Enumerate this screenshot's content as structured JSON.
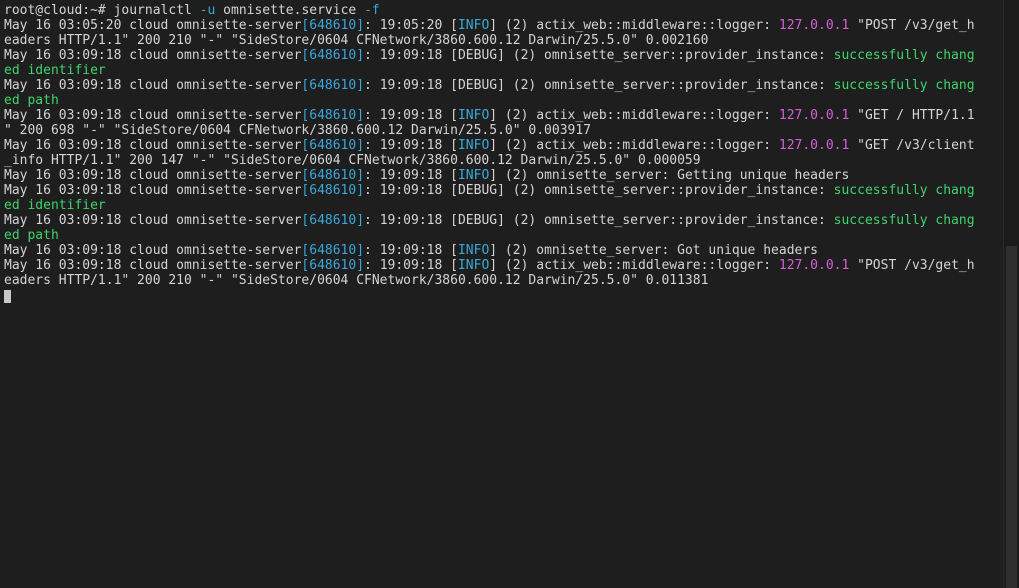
{
  "prompt": {
    "user_host": "root@cloud:~#",
    "command": "journalctl",
    "option": "-u",
    "argument": "omnisette.service",
    "flag": "-f"
  },
  "lines": [
    [
      {
        "t": "May 16 03:05:20 cloud omnisette-server"
      },
      {
        "t": "[648610]",
        "c": "blue"
      },
      {
        "t": ": 19:05:20 ["
      },
      {
        "t": "INFO",
        "c": "blue"
      },
      {
        "t": "] (2) actix_web::middleware::logger: "
      },
      {
        "t": "127.0.0.1",
        "c": "magenta"
      },
      {
        "t": " \"POST /v3/get_h"
      }
    ],
    [
      {
        "t": "eaders HTTP/1.1\" 200 210 \"-\" \"SideStore/0604 CFNetwork/3860.600.12 Darwin/25.5.0\" 0.002160"
      }
    ],
    [
      {
        "t": "May 16 03:09:18 cloud omnisette-server"
      },
      {
        "t": "[648610]",
        "c": "blue"
      },
      {
        "t": ": 19:09:18 [DEBUG] (2) omnisette_server::provider_instance: "
      },
      {
        "t": "successfully chang",
        "c": "green"
      }
    ],
    [
      {
        "t": "ed identifier",
        "c": "green"
      }
    ],
    [
      {
        "t": "May 16 03:09:18 cloud omnisette-server"
      },
      {
        "t": "[648610]",
        "c": "blue"
      },
      {
        "t": ": 19:09:18 [DEBUG] (2) omnisette_server::provider_instance: "
      },
      {
        "t": "successfully chang",
        "c": "green"
      }
    ],
    [
      {
        "t": "ed path",
        "c": "green"
      }
    ],
    [
      {
        "t": "May 16 03:09:18 cloud omnisette-server"
      },
      {
        "t": "[648610]",
        "c": "blue"
      },
      {
        "t": ": 19:09:18 ["
      },
      {
        "t": "INFO",
        "c": "blue"
      },
      {
        "t": "] (2) actix_web::middleware::logger: "
      },
      {
        "t": "127.0.0.1",
        "c": "magenta"
      },
      {
        "t": " \"GET / HTTP/1.1"
      }
    ],
    [
      {
        "t": "\" 200 698 \"-\" \"SideStore/0604 CFNetwork/3860.600.12 Darwin/25.5.0\" 0.003917"
      }
    ],
    [
      {
        "t": "May 16 03:09:18 cloud omnisette-server"
      },
      {
        "t": "[648610]",
        "c": "blue"
      },
      {
        "t": ": 19:09:18 ["
      },
      {
        "t": "INFO",
        "c": "blue"
      },
      {
        "t": "] (2) actix_web::middleware::logger: "
      },
      {
        "t": "127.0.0.1",
        "c": "magenta"
      },
      {
        "t": " \"GET /v3/client"
      }
    ],
    [
      {
        "t": "_info HTTP/1.1\" 200 147 \"-\" \"SideStore/0604 CFNetwork/3860.600.12 Darwin/25.5.0\" 0.000059"
      }
    ],
    [
      {
        "t": "May 16 03:09:18 cloud omnisette-server"
      },
      {
        "t": "[648610]",
        "c": "blue"
      },
      {
        "t": ": 19:09:18 ["
      },
      {
        "t": "INFO",
        "c": "blue"
      },
      {
        "t": "] (2) omnisette_server: Getting unique headers"
      }
    ],
    [
      {
        "t": "May 16 03:09:18 cloud omnisette-server"
      },
      {
        "t": "[648610]",
        "c": "blue"
      },
      {
        "t": ": 19:09:18 [DEBUG] (2) omnisette_server::provider_instance: "
      },
      {
        "t": "successfully chang",
        "c": "green"
      }
    ],
    [
      {
        "t": "ed identifier",
        "c": "green"
      }
    ],
    [
      {
        "t": "May 16 03:09:18 cloud omnisette-server"
      },
      {
        "t": "[648610]",
        "c": "blue"
      },
      {
        "t": ": 19:09:18 [DEBUG] (2) omnisette_server::provider_instance: "
      },
      {
        "t": "successfully chang",
        "c": "green"
      }
    ],
    [
      {
        "t": "ed path",
        "c": "green"
      }
    ],
    [
      {
        "t": "May 16 03:09:18 cloud omnisette-server"
      },
      {
        "t": "[648610]",
        "c": "blue"
      },
      {
        "t": ": 19:09:18 ["
      },
      {
        "t": "INFO",
        "c": "blue"
      },
      {
        "t": "] (2) omnisette_server: Got unique headers"
      }
    ],
    [
      {
        "t": "May 16 03:09:18 cloud omnisette-server"
      },
      {
        "t": "[648610]",
        "c": "blue"
      },
      {
        "t": ": 19:09:18 ["
      },
      {
        "t": "INFO",
        "c": "blue"
      },
      {
        "t": "] (2) actix_web::middleware::logger: "
      },
      {
        "t": "127.0.0.1",
        "c": "magenta"
      },
      {
        "t": " \"POST /v3/get_h"
      }
    ],
    [
      {
        "t": "eaders HTTP/1.1\" 200 210 \"-\" \"SideStore/0604 CFNetwork/3860.600.12 Darwin/25.5.0\" 0.011381"
      }
    ]
  ],
  "colors": {
    "background": "#1e1e1e",
    "text": "#d4d4d4",
    "blue": "#3aa8dc",
    "magenta": "#d75fd7",
    "green": "#3fd46b"
  }
}
